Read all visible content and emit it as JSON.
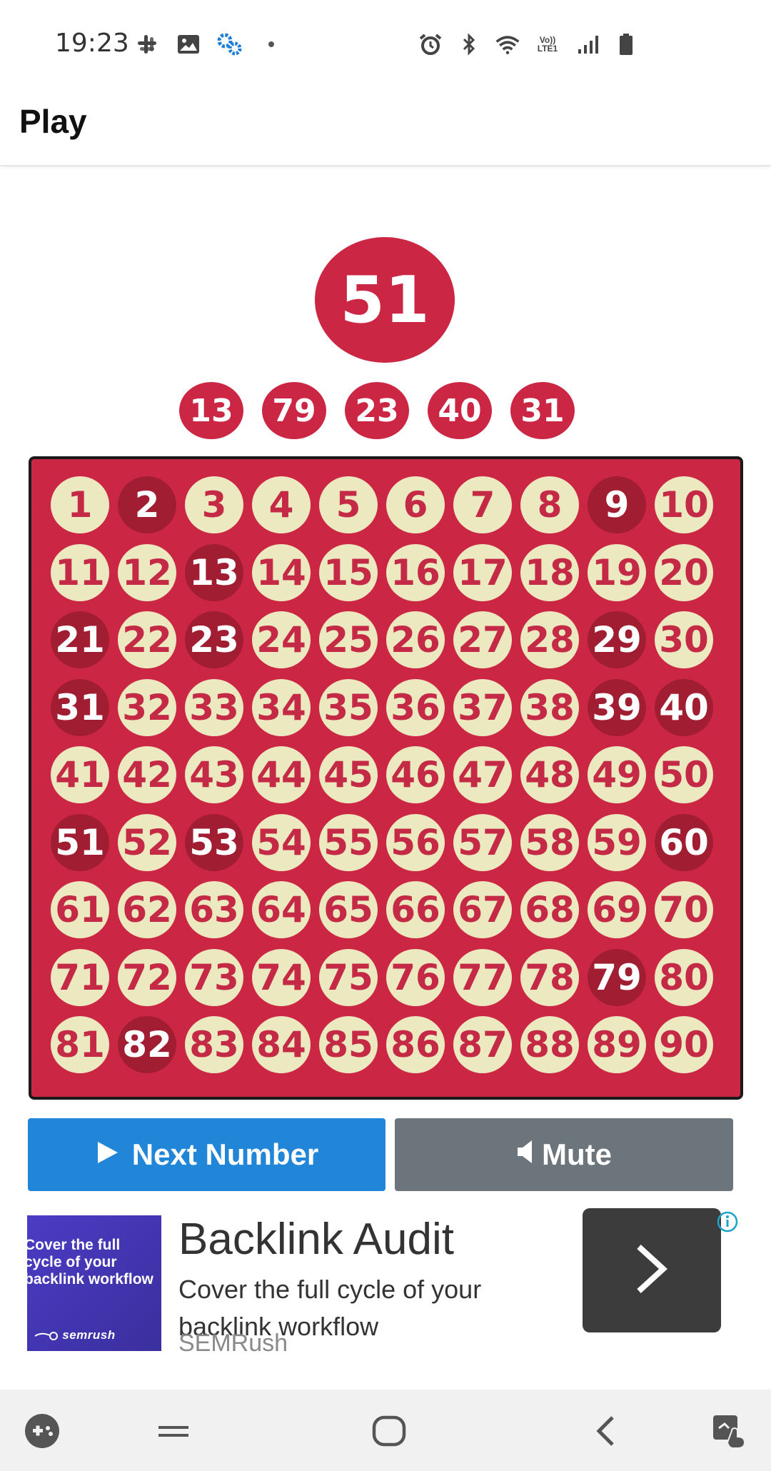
{
  "status_bar": {
    "time": "19:23",
    "left_icons": [
      "slack-icon",
      "image-icon",
      "settings-gear-icon",
      "dot-icon"
    ],
    "right_icons": [
      "alarm-icon",
      "bluetooth-icon",
      "wifi-icon",
      "volte-icon",
      "signal-icon",
      "battery-icon"
    ],
    "volte_label": "Vo)) LTE1"
  },
  "app_bar": {
    "title": "Play"
  },
  "current_number": "51",
  "recent_numbers": [
    "13",
    "79",
    "23",
    "40",
    "31"
  ],
  "board": {
    "numbers": [
      "1",
      "2",
      "3",
      "4",
      "5",
      "6",
      "7",
      "8",
      "9",
      "10",
      "11",
      "12",
      "13",
      "14",
      "15",
      "16",
      "17",
      "18",
      "19",
      "20",
      "21",
      "22",
      "23",
      "24",
      "25",
      "26",
      "27",
      "28",
      "29",
      "30",
      "31",
      "32",
      "33",
      "34",
      "35",
      "36",
      "37",
      "38",
      "39",
      "40",
      "41",
      "42",
      "43",
      "44",
      "45",
      "46",
      "47",
      "48",
      "49",
      "50",
      "51",
      "52",
      "53",
      "54",
      "55",
      "56",
      "57",
      "58",
      "59",
      "60",
      "61",
      "62",
      "63",
      "64",
      "65",
      "66",
      "67",
      "68",
      "69",
      "70",
      "71",
      "72",
      "73",
      "74",
      "75",
      "76",
      "77",
      "78",
      "79",
      "80",
      "81",
      "82",
      "83",
      "84",
      "85",
      "86",
      "87",
      "88",
      "89",
      "90"
    ],
    "called": [
      "2",
      "9",
      "13",
      "21",
      "23",
      "29",
      "31",
      "39",
      "40",
      "51",
      "53",
      "60",
      "79",
      "82"
    ]
  },
  "buttons": {
    "next_label": "Next Number",
    "mute_label": "Mute"
  },
  "ad": {
    "image_text": "Cover the full cycle of your backlink workflow",
    "image_logo": "semrush",
    "headline": "Backlink Audit",
    "body": "Cover the full cycle of your backlink workflow",
    "advertiser": "SEMRush"
  },
  "nav_bar": {
    "items": [
      "game-launcher-icon",
      "recent-apps-icon",
      "home-icon",
      "back-icon",
      "screen-touch-icon"
    ]
  },
  "colors": {
    "board_red": "#cc2645",
    "marked": "#a11d32",
    "unmarked": "#ece8bf",
    "next_blue": "#2185d8",
    "mute_gray": "#6c757c"
  }
}
